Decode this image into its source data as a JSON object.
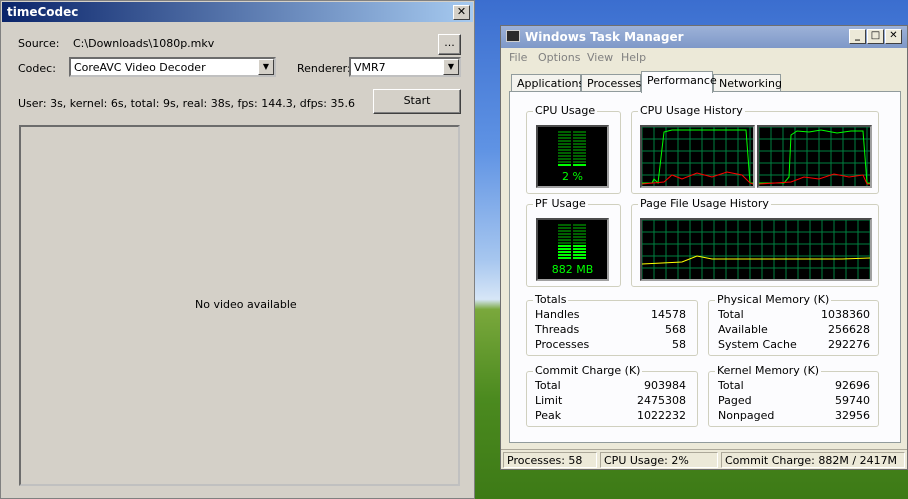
{
  "timecodec": {
    "title": "timeCodec",
    "source_label": "Source:",
    "source_value": "C:\\Downloads\\1080p.mkv",
    "browse_label": "...",
    "codec_label": "Codec:",
    "codec_value": "CoreAVC Video Decoder",
    "renderer_label": "Renderer:",
    "renderer_value": "VMR7",
    "stats": "User: 3s, kernel: 6s, total: 9s, real: 38s, fps: 144.3, dfps: 35.6",
    "start_label": "Start",
    "video_text": "No video available"
  },
  "taskmgr": {
    "title": "Windows Task Manager",
    "menu": [
      "File",
      "Options",
      "View",
      "Help"
    ],
    "tabs": [
      "Applications",
      "Processes",
      "Performance",
      "Networking"
    ],
    "active_tab": "Performance",
    "cpu_usage_label": "CPU Usage",
    "cpu_usage_value": "2 %",
    "cpu_usage_percent": 2,
    "cpu_history_label": "CPU Usage History",
    "pf_usage_label": "PF Usage",
    "pf_usage_value": "882 MB",
    "pf_history_label": "Page File Usage History",
    "totals": {
      "title": "Totals",
      "rows": [
        {
          "label": "Handles",
          "value": "14578"
        },
        {
          "label": "Threads",
          "value": "568"
        },
        {
          "label": "Processes",
          "value": "58"
        }
      ]
    },
    "physical": {
      "title": "Physical Memory (K)",
      "rows": [
        {
          "label": "Total",
          "value": "1038360"
        },
        {
          "label": "Available",
          "value": "256628"
        },
        {
          "label": "System Cache",
          "value": "292276"
        }
      ]
    },
    "commit": {
      "title": "Commit Charge (K)",
      "rows": [
        {
          "label": "Total",
          "value": "903984"
        },
        {
          "label": "Limit",
          "value": "2475308"
        },
        {
          "label": "Peak",
          "value": "1022232"
        }
      ]
    },
    "kernel": {
      "title": "Kernel Memory (K)",
      "rows": [
        {
          "label": "Total",
          "value": "92696"
        },
        {
          "label": "Paged",
          "value": "59740"
        },
        {
          "label": "Nonpaged",
          "value": "32956"
        }
      ]
    },
    "status": {
      "processes": "Processes: 58",
      "cpu": "CPU Usage: 2%",
      "commit": "Commit Charge: 882M / 2417M"
    }
  },
  "colors": {
    "graph_green": "#00ff00",
    "graph_red": "#ff0000",
    "graph_yellow": "#ffff00",
    "grid": "#008040"
  }
}
